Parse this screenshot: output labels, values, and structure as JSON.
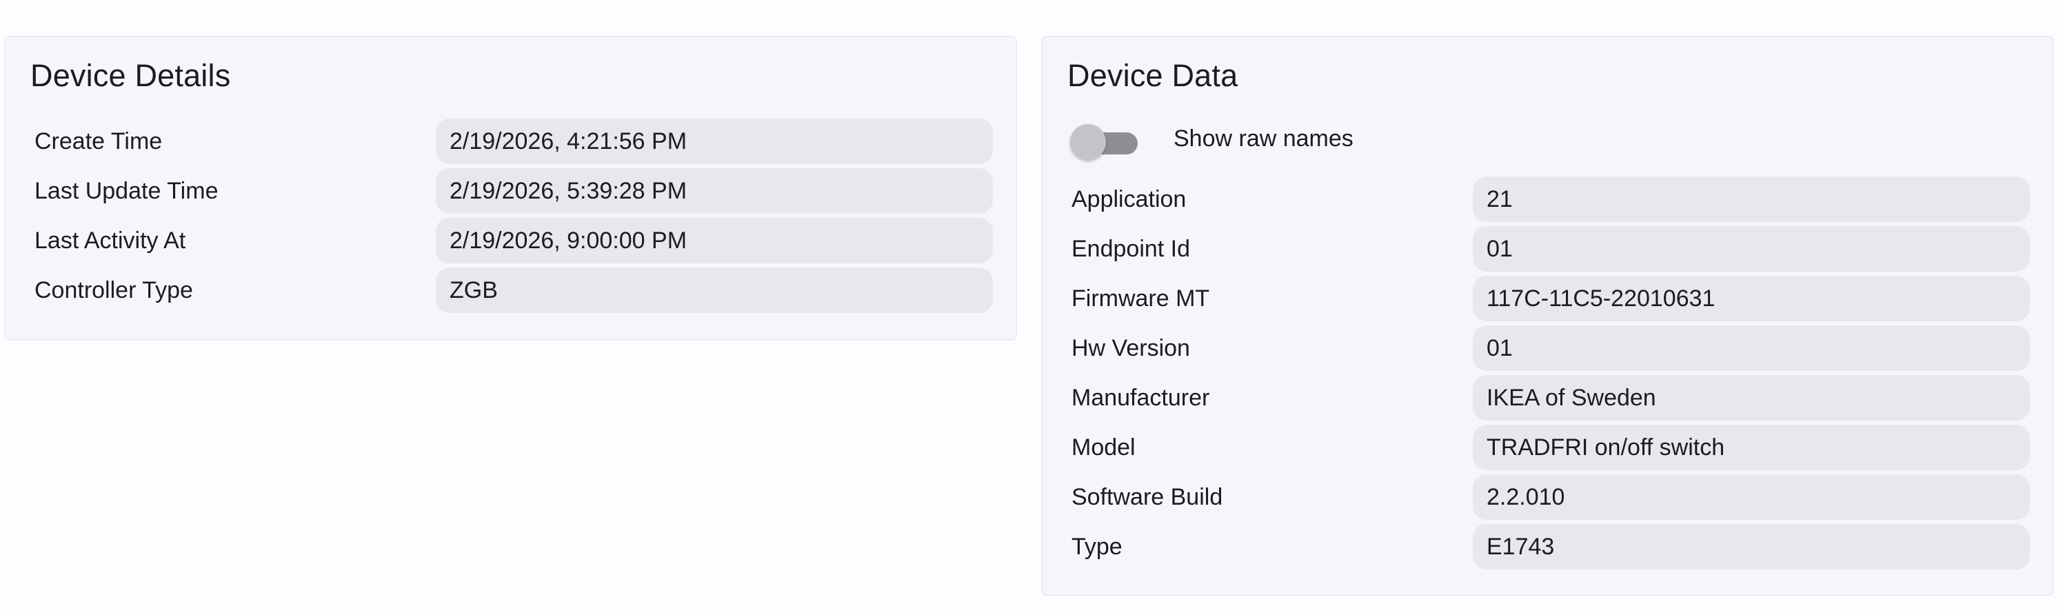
{
  "device_details": {
    "title": "Device Details",
    "rows": [
      {
        "label": "Create Time",
        "value": "2/19/2026, 4:21:56 PM"
      },
      {
        "label": "Last Update Time",
        "value": "2/19/2026, 5:39:28 PM"
      },
      {
        "label": "Last Activity At",
        "value": "2/19/2026, 9:00:00 PM"
      },
      {
        "label": "Controller Type",
        "value": "ZGB"
      }
    ]
  },
  "device_data": {
    "title": "Device Data",
    "toggle": {
      "label": "Show raw names",
      "checked": false
    },
    "rows": [
      {
        "label": "Application",
        "value": "21"
      },
      {
        "label": "Endpoint Id",
        "value": "01"
      },
      {
        "label": "Firmware MT",
        "value": "117C-11C5-22010631"
      },
      {
        "label": "Hw Version",
        "value": "01"
      },
      {
        "label": "Manufacturer",
        "value": "IKEA of Sweden"
      },
      {
        "label": "Model",
        "value": "TRADFRI on/off switch"
      },
      {
        "label": "Software Build",
        "value": "2.2.010"
      },
      {
        "label": "Type",
        "value": "E1743"
      }
    ]
  },
  "colors": {
    "card_background": "#f6f5fa",
    "value_background": "#e8e7ee",
    "toggle_track": "#8f8e94",
    "toggle_thumb": "#c4c3c9"
  }
}
